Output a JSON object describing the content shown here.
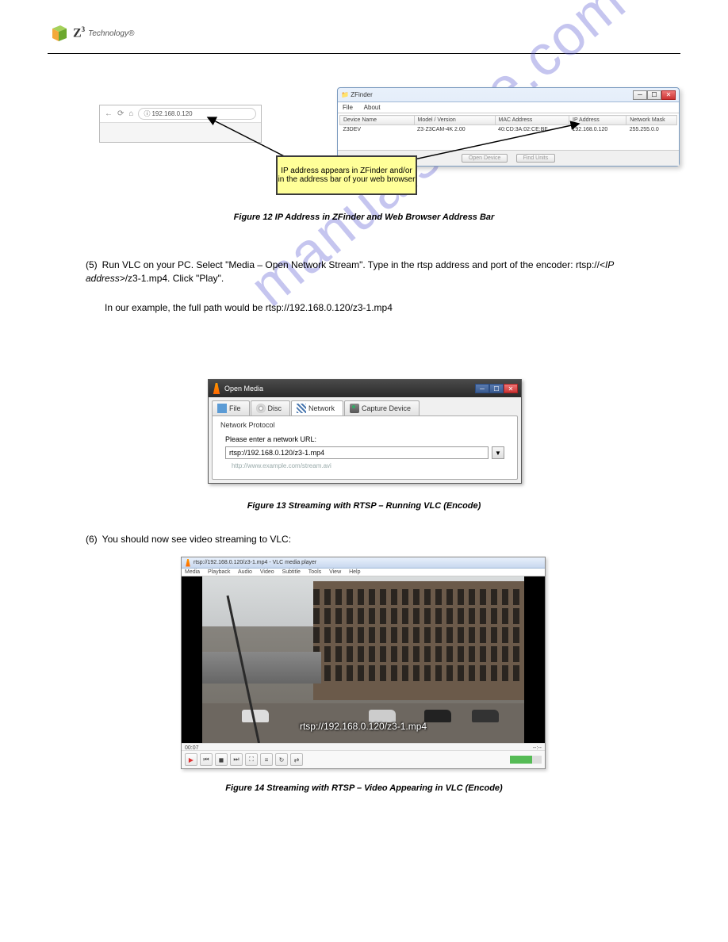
{
  "header": {
    "brand": "Technology",
    "brand_mark": "Z",
    "brand_sup": "3",
    "reg": "®"
  },
  "browser": {
    "address_prefix": "ⓘ",
    "address": "192.168.0.120"
  },
  "zfinder": {
    "title": "ZFinder",
    "menu": [
      "File",
      "About"
    ],
    "columns": [
      "Device Name",
      "Model / Version",
      "MAC Address",
      "IP Address",
      "Network Mask"
    ],
    "row": {
      "device_name": "Z3DEV",
      "model": "Z3·Z3CAM-4K 2.00",
      "mac": "40:CD:3A:02:CE:BF",
      "ip": "192.168.0.120",
      "mask": "255.255.0.0"
    },
    "buttons": [
      "Open Device",
      "Find Units"
    ]
  },
  "note": "IP address appears in ZFinder and/or in the address bar of your web browser",
  "figure12": "Figure 12  IP Address in ZFinder and Web Browser Address Bar",
  "instr5": {
    "prefix": "(5)",
    "line1": "Run VLC on your PC. Select \"Media – Open Network Stream\". Type in the rtsp address and port of the encoder: rtsp://",
    "ipref": "<IP address>",
    "line1b": "/z3-1.mp4. Click \"Play\".",
    "line2": "In our example, the full path would be rtsp://192.168.0.120/z3-1.mp4"
  },
  "vlc_open": {
    "title": "Open Media",
    "tabs": {
      "file": "File",
      "disc": "Disc",
      "network": "Network",
      "capture": "Capture Device"
    },
    "section": "Network Protocol",
    "url_label": "Please enter a network URL:",
    "url_value": "rtsp://192.168.0.120/z3-1.mp4",
    "hint": "http://www.example.com/stream.avi"
  },
  "figure13": "Figure 13  Streaming with RTSP – Running VLC (Encode)",
  "instr6": {
    "prefix": "(6)",
    "text": "You should now see video streaming to VLC:"
  },
  "player": {
    "title": "rtsp://192.168.0.120/z3-1.mp4 - VLC media player",
    "menu": [
      "Media",
      "Playback",
      "Audio",
      "Video",
      "Subtitle",
      "Tools",
      "View",
      "Help"
    ],
    "overlay": "rtsp://192.168.0.120/z3-1.mp4",
    "time_left": "00:07",
    "time_right": "--:--"
  },
  "figure14": "Figure 14  Streaming with RTSP – Video Appearing in VLC (Encode)",
  "watermark": "manualshive.com"
}
